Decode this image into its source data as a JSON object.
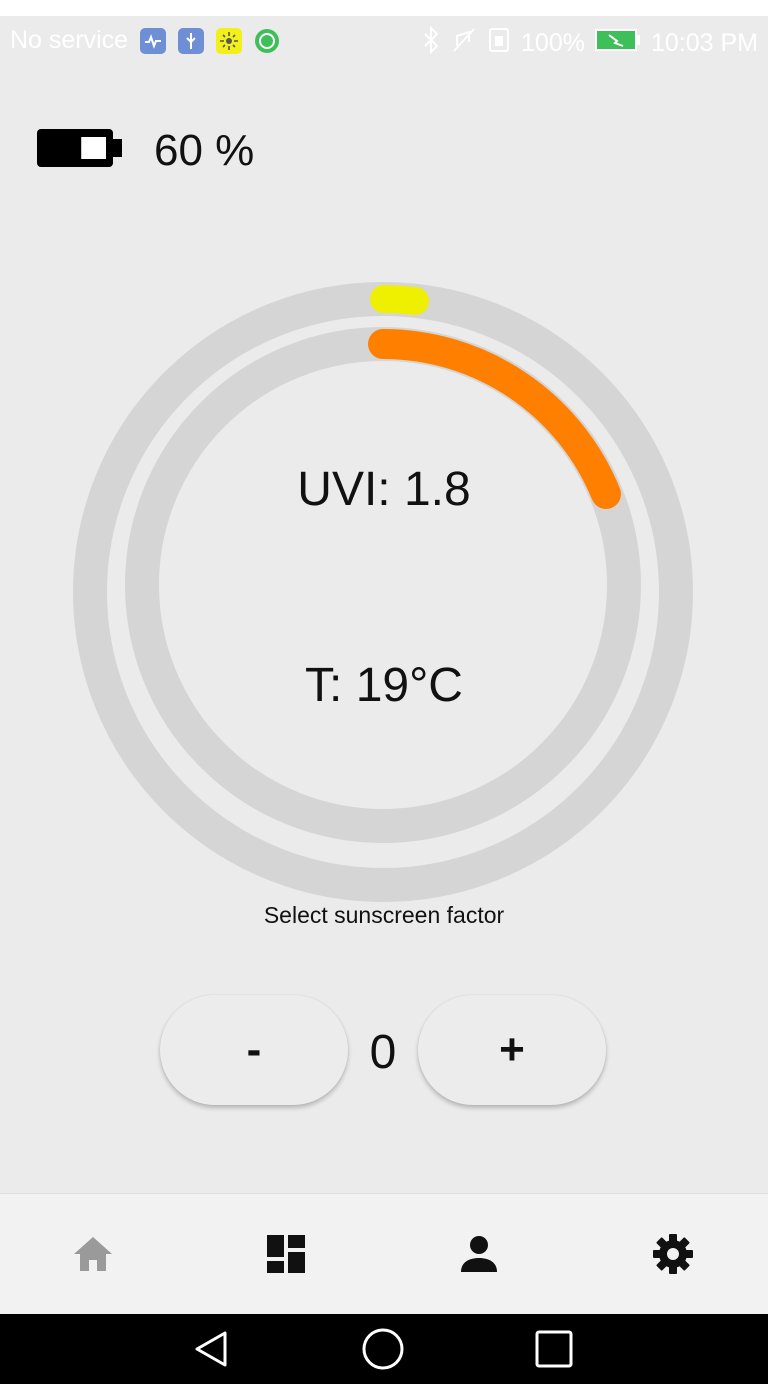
{
  "status_bar": {
    "carrier": "No service",
    "battery": "100%",
    "time": "10:03 PM"
  },
  "device": {
    "battery_label": "60 %",
    "battery_level": 0.6
  },
  "gauge": {
    "uvi_label": "UVI: 1.8",
    "temperature_label": "T: 19°C",
    "uv_arc_color": "#ff8000",
    "outer_marker_color": "#eef000",
    "track_color": "#d5d5d5"
  },
  "sunscreen": {
    "label": "Select sunscreen factor",
    "minus_label": "-",
    "value": "0",
    "plus_label": "+"
  },
  "bottom_nav": {
    "items": [
      "home-icon",
      "dashboard-icon",
      "person-icon",
      "settings-icon"
    ]
  },
  "system_nav": {
    "items": [
      "back-icon",
      "home-circle-icon",
      "recents-icon"
    ]
  }
}
